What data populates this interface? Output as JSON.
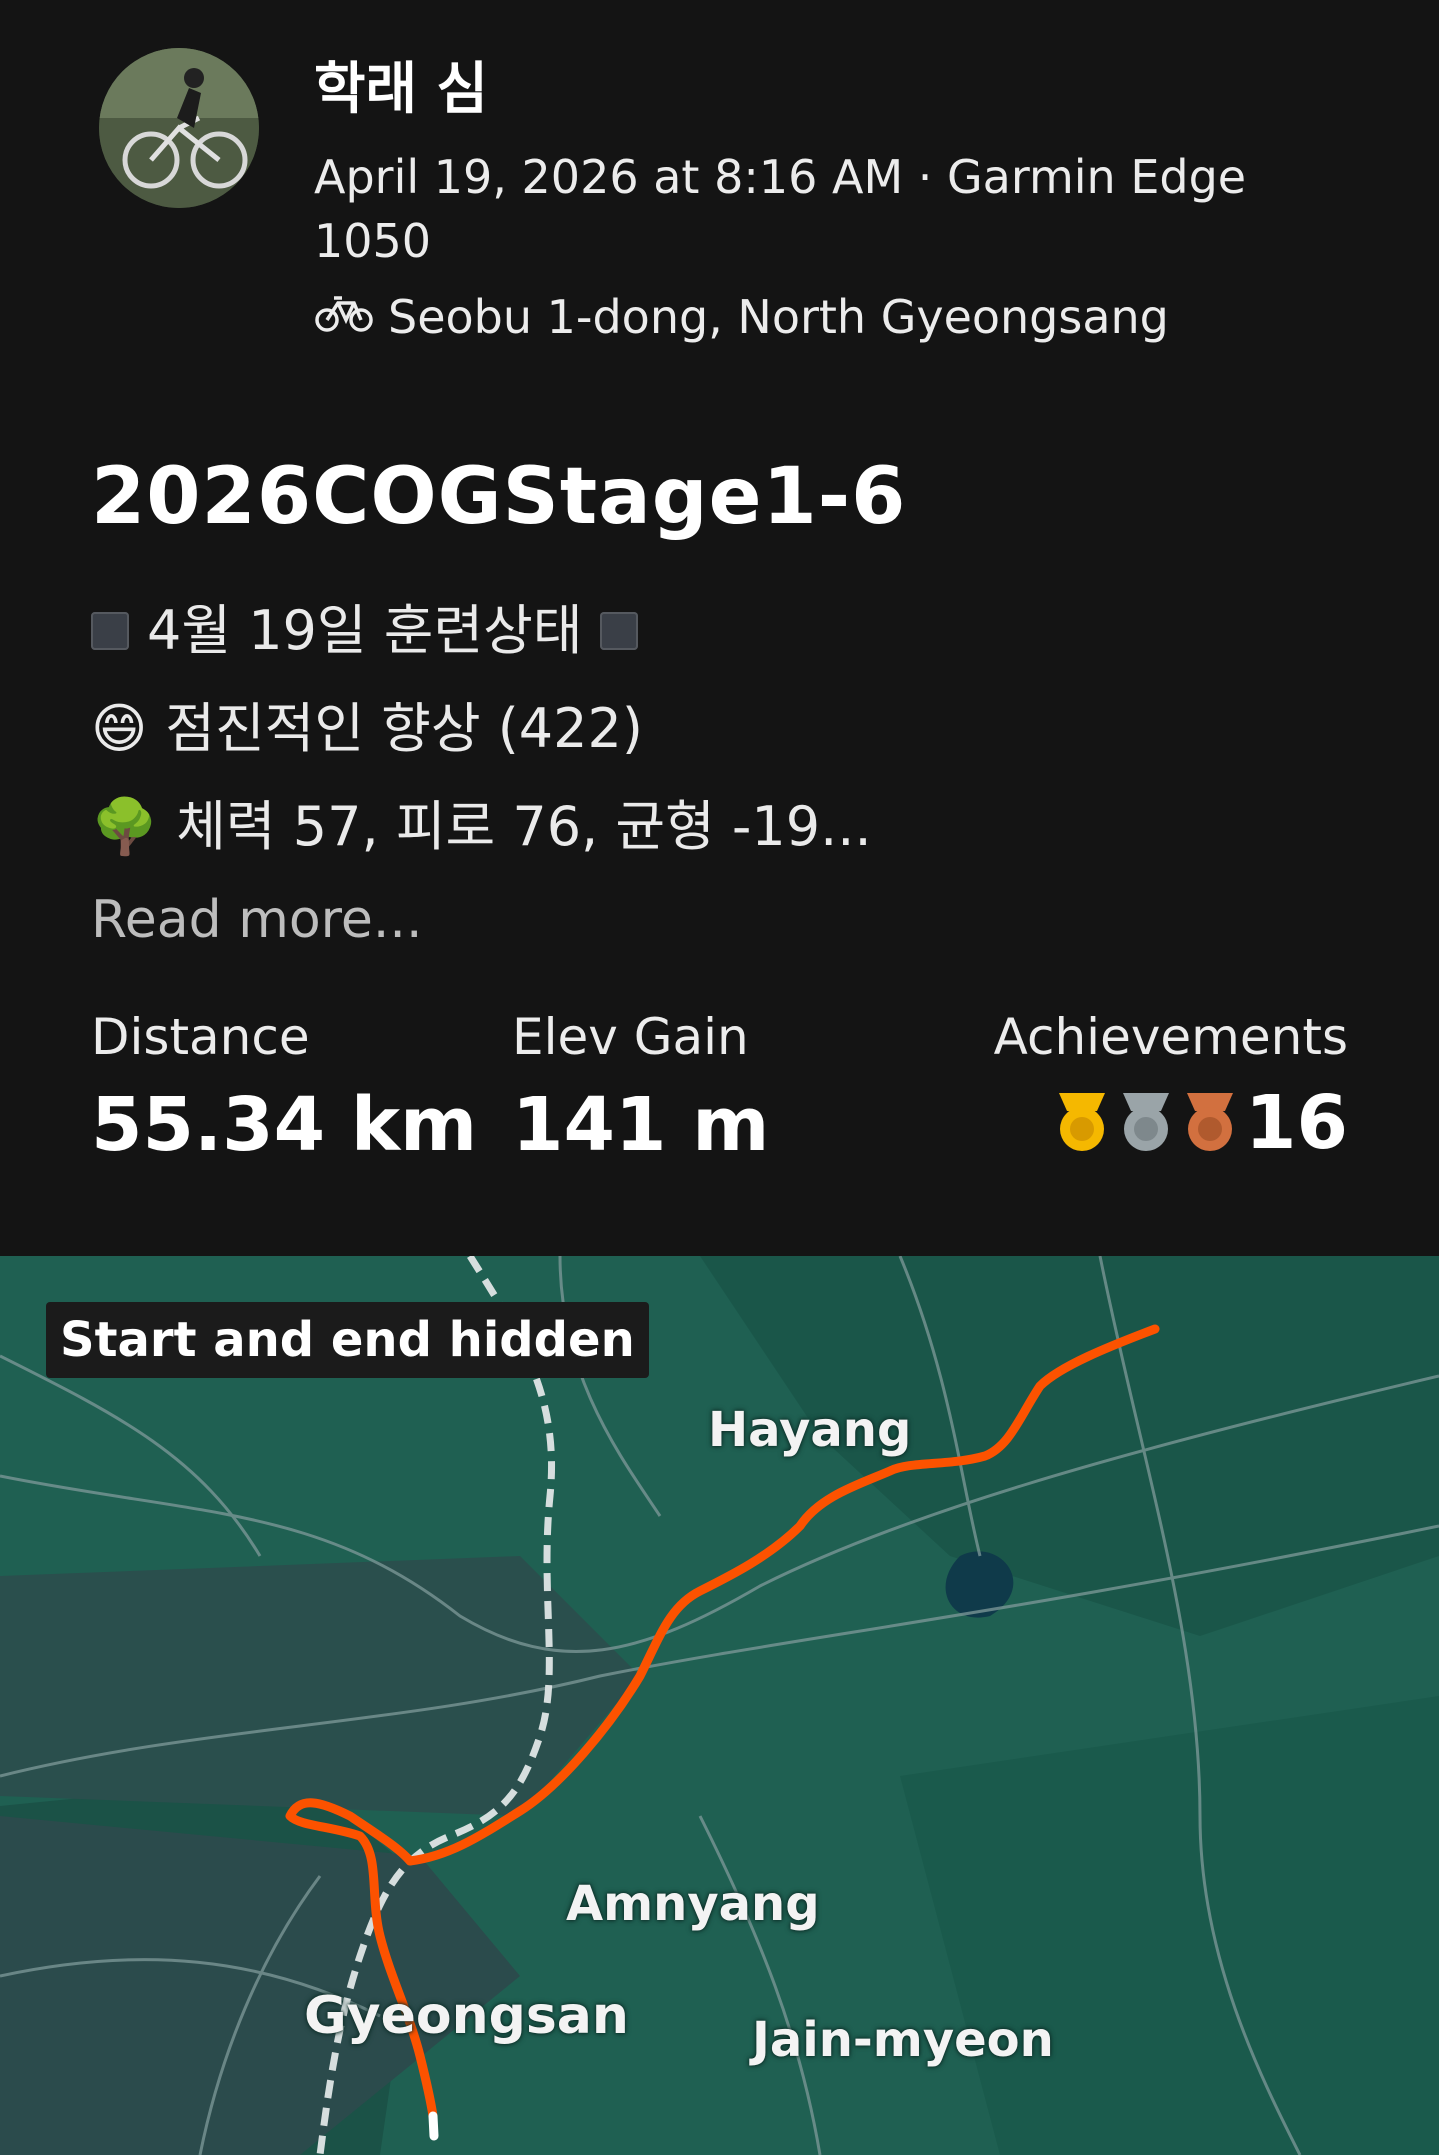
{
  "author": {
    "name": "학래 심"
  },
  "activity": {
    "meta": "April 19, 2026 at 8:16 AM · Garmin Edge 1050",
    "location": "Seobu 1-dong, North Gyeongsang",
    "title": "2026COGStage1-6",
    "description": {
      "line1": "4월 19일 훈련상태",
      "line2_emoji": "😄",
      "line2": "점진적인 향상 (422)",
      "line3_emoji": "🌳",
      "line3": "체력 57, 피로 76, 균형 -19..."
    },
    "read_more": "Read more..."
  },
  "stats": {
    "distance_label": "Distance",
    "distance_value": "55.34 km",
    "elev_label": "Elev Gain",
    "elev_value": "141 m",
    "achievements_label": "Achievements",
    "achievements_value": "16"
  },
  "map": {
    "badge": "Start and end hidden",
    "places": {
      "hayang": "Hayang",
      "amnyang": "Amnyang",
      "gyeongsan": "Gyeongsan",
      "jain": "Jain-myeon"
    },
    "route_color": "#fc5200"
  },
  "colors": {
    "gold": "#f5b800",
    "silver": "#9aa4a8",
    "bronze": "#d2703f"
  }
}
